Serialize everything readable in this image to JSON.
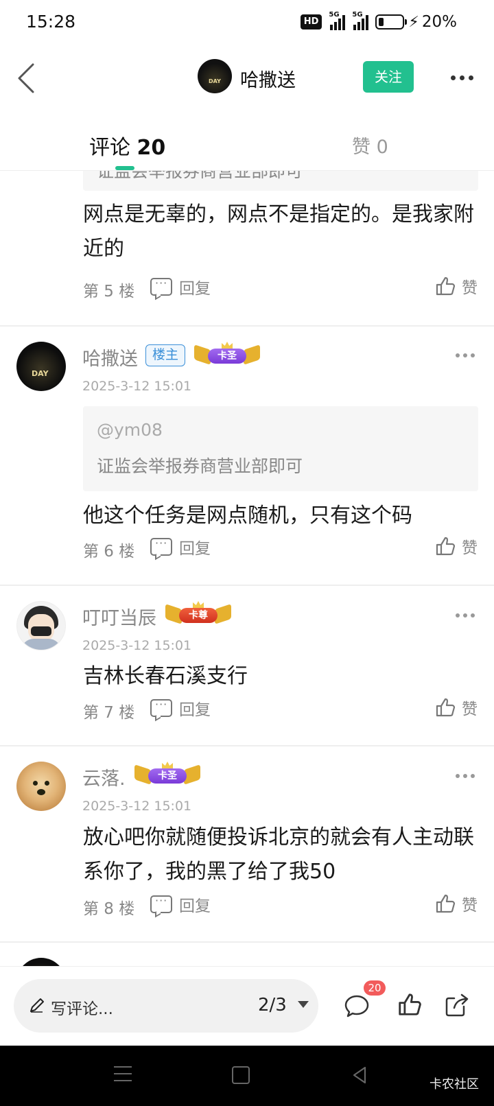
{
  "status_bar": {
    "time": "15:28",
    "hd_label": "HD",
    "network_1": "5G",
    "network_2": "5G",
    "battery_level": 0.2,
    "battery_text": "20%"
  },
  "header": {
    "username": "哈撒送",
    "follow_label": "关注",
    "avatar_text": "DAY"
  },
  "tabs": {
    "comments_label": "评论",
    "comments_count": "20",
    "likes_label": "赞",
    "likes_count": "0"
  },
  "comments": [
    {
      "quote_text": "证监会举报券商营业部即可",
      "body": "网点是无辜的，网点不是指定的。是我家附近的",
      "floor": "第 5 楼",
      "reply_label": "回复",
      "like_label": "赞"
    },
    {
      "username": "哈撒送",
      "op_badge": "楼主",
      "rank": "卡圣",
      "timestamp": "2025-3-12 15:01",
      "quote_user": "@ym08",
      "quote_text": "证监会举报券商营业部即可",
      "body": "他这个任务是网点随机，只有这个码",
      "floor": "第 6 楼",
      "reply_label": "回复",
      "like_label": "赞"
    },
    {
      "username": "叮叮当辰",
      "rank": "卡尊",
      "timestamp": "2025-3-12 15:01",
      "body": "吉林长春石溪支行",
      "floor": "第 7 楼",
      "reply_label": "回复",
      "like_label": "赞"
    },
    {
      "username": "云落.",
      "rank": "卡圣",
      "timestamp": "2025-3-12 15:01",
      "body": "放心吧你就随便投诉北京的就会有人主动联系你了，我的黑了给了我50",
      "floor": "第 8 楼",
      "reply_label": "回复",
      "like_label": "赞"
    }
  ],
  "bottom_bar": {
    "comment_placeholder": "写评论...",
    "page_indicator": "2/3",
    "comment_count_badge": "20"
  },
  "nav_bar": {
    "watermark": "卡农社区"
  },
  "colors": {
    "accent_green": "#22c08f",
    "op_badge_blue": "#3a8fd8",
    "badge_red": "#f25b5b"
  },
  "icons": [
    "back-icon",
    "more-icon",
    "reply-icon",
    "thumb-up-icon",
    "pen-icon",
    "comment-icon",
    "share-icon",
    "caret-down-icon",
    "menu-icon",
    "home-icon",
    "nav-back-icon"
  ]
}
